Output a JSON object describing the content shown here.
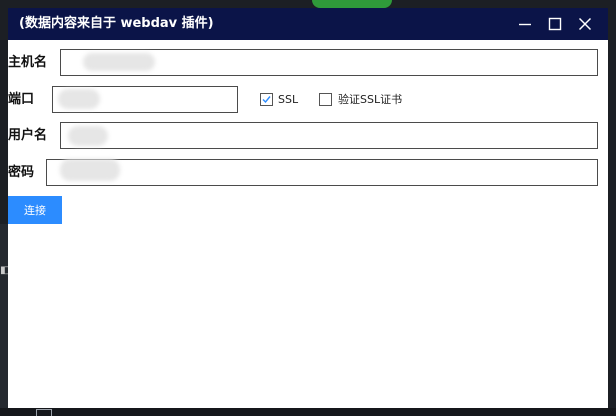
{
  "window": {
    "title": "(数据内容来自于 webdav 插件)"
  },
  "form": {
    "host_label": "主机名",
    "host_value": "",
    "port_label": "端口",
    "port_value": "",
    "ssl_label": "SSL",
    "ssl_checked": true,
    "verify_ssl_label": "验证SSL证书",
    "verify_ssl_checked": false,
    "username_label": "用户名",
    "username_value": "",
    "password_label": "密码",
    "password_value": ""
  },
  "actions": {
    "connect_label": "连接"
  },
  "colors": {
    "titlebar": "#0b1448",
    "accent": "#2c8cff"
  },
  "icons": [
    "minimize-icon",
    "maximize-icon",
    "close-icon",
    "checkmark-icon"
  ]
}
